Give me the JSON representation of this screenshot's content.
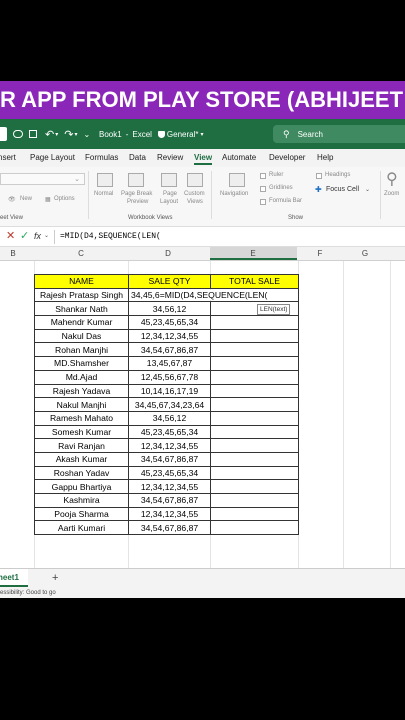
{
  "banner": {
    "text": "R APP FROM PLAY STORE (ABHIJEET"
  },
  "titlebar": {
    "book_name": "Book1",
    "separator": "-",
    "app_name": "Excel",
    "sensitivity": "General*",
    "search_placeholder": "Search"
  },
  "menu": {
    "items": [
      "nsert",
      "Page Layout",
      "Formulas",
      "Data",
      "Review",
      "View",
      "Automate",
      "Developer",
      "Help"
    ],
    "active": "View"
  },
  "ribbon": {
    "new_label": "New",
    "options_label": "Options",
    "sheet_view_group": "eet View",
    "normal": "Normal",
    "page_break_1": "Page Break",
    "page_break_2": "Preview",
    "page_layout_1": "Page",
    "page_layout_2": "Layout",
    "custom_1": "Custom",
    "custom_2": "Views",
    "workbook_views_group": "Workbook Views",
    "navigation": "Navigation",
    "ruler": "Ruler",
    "gridlines": "Gridlines",
    "formula_bar": "Formula Bar",
    "headings": "Headings",
    "focus_cell": "Focus Cell",
    "show_group": "Show",
    "zoom": "Zoom"
  },
  "formula_bar": {
    "fx": "fx",
    "formula": "=MID(D4,SEQUENCE(LEN("
  },
  "columns": [
    "B",
    "C",
    "D",
    "E",
    "F",
    "G"
  ],
  "table": {
    "headers": [
      "NAME",
      "SALE QTY",
      "TOTAL SALE"
    ],
    "editing_cell": {
      "name": "Rajesh Pratasp Singh",
      "qty_prefix": "34,45,6",
      "formula": "=MID(D4,SEQUENCE(LEN("
    },
    "rows": [
      {
        "name": "Shankar Nath",
        "qty": "34,56,12"
      },
      {
        "name": "Mahendr Kumar",
        "qty": "45,23,45,65,34"
      },
      {
        "name": "Nakul Das",
        "qty": "12,34,12,34,55"
      },
      {
        "name": "Rohan Manjhi",
        "qty": "34,54,67,86,87"
      },
      {
        "name": "MD.Shamsher",
        "qty": "13,45,67,87"
      },
      {
        "name": "Md.Ajad",
        "qty": "12,45,56,67,78"
      },
      {
        "name": "Rajesh Yadava",
        "qty": "10,14,16,17,19"
      },
      {
        "name": "Nakul Manjhi",
        "qty": "34,45,67,34,23,64"
      },
      {
        "name": "Ramesh Mahato",
        "qty": "34,56,12"
      },
      {
        "name": "Somesh Kumar",
        "qty": "45,23,45,65,34"
      },
      {
        "name": "Ravi Ranjan",
        "qty": "12,34,12,34,55"
      },
      {
        "name": "Akash Kumar",
        "qty": "34,54,67,86,87"
      },
      {
        "name": "Roshan Yadav",
        "qty": "45,23,45,65,34"
      },
      {
        "name": "Gappu Bhartiya",
        "qty": "12,34,12,34,55"
      },
      {
        "name": "Kashmira",
        "qty": "34,54,67,86,87"
      },
      {
        "name": "Pooja Sharma",
        "qty": "12,34,12,34,55"
      },
      {
        "name": "Aarti Kumari",
        "qty": "34,54,67,86,87"
      }
    ]
  },
  "tooltip": {
    "text": "LEN(text)"
  },
  "sheet_tabs": {
    "active": "heet1",
    "add": "+"
  },
  "status": {
    "text": "essibility: Good to go"
  },
  "colors": {
    "banner": "#8b27b8",
    "excel_green": "#1e6e42",
    "header_fill": "#ffff00"
  }
}
